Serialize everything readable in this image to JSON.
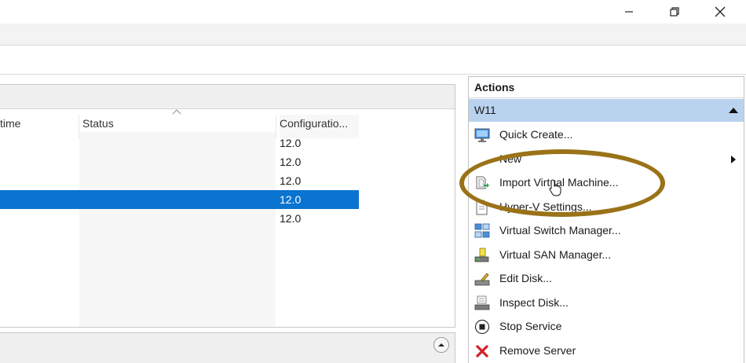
{
  "vm_list": {
    "columns": {
      "uptime_partial": "time",
      "status": "Status",
      "configuration": "Configuratio..."
    },
    "rows": [
      {
        "configuration": "12.0",
        "selected": false
      },
      {
        "configuration": "12.0",
        "selected": false
      },
      {
        "configuration": "12.0",
        "selected": false
      },
      {
        "configuration": "12.0",
        "selected": true
      },
      {
        "configuration": "12.0",
        "selected": false
      }
    ]
  },
  "actions": {
    "title": "Actions",
    "group": "W11",
    "items": [
      {
        "label": "Quick Create...",
        "icon": "monitor-icon"
      },
      {
        "label": "New",
        "icon": "none",
        "submenu": true
      },
      {
        "label": "Import Virtual Machine...",
        "icon": "import-vm-icon"
      },
      {
        "label": "Hyper-V Settings...",
        "icon": "settings-doc-icon"
      },
      {
        "label": "Virtual Switch Manager...",
        "icon": "network-switch-icon"
      },
      {
        "label": "Virtual SAN Manager...",
        "icon": "san-icon"
      },
      {
        "label": "Edit Disk...",
        "icon": "edit-disk-icon"
      },
      {
        "label": "Inspect Disk...",
        "icon": "inspect-disk-icon"
      },
      {
        "label": "Stop Service",
        "icon": "stop-icon"
      },
      {
        "label": "Remove Server",
        "icon": "remove-x-icon"
      }
    ]
  },
  "colors": {
    "selection": "#0a74d0",
    "group_header": "#b9d3ef",
    "highlight_ring": "#9a7218",
    "remove_red": "#d32027"
  }
}
